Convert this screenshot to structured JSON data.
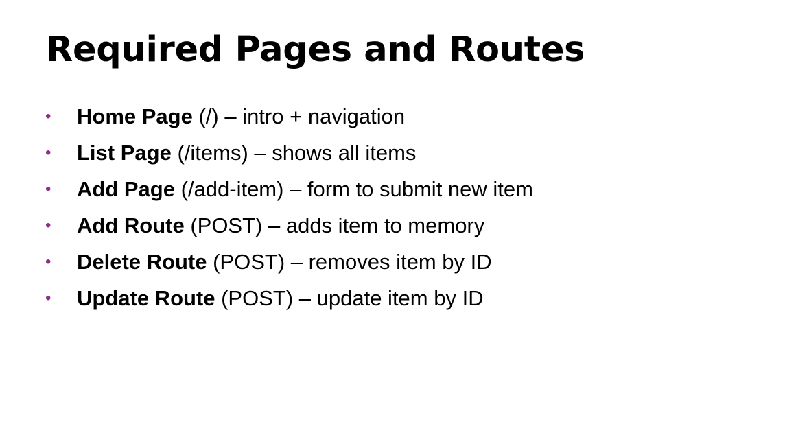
{
  "slide": {
    "title": "Required Pages and Routes",
    "bullet_color": "#8b2f8b",
    "bullet_glyph": "•",
    "items": [
      {
        "bold": "Home Page",
        "rest": " (/) – intro + navigation"
      },
      {
        "bold": "List Page",
        "rest": " (/items) – shows all items"
      },
      {
        "bold": "Add Page",
        "rest": " (/add-item) – form to submit new item"
      },
      {
        "bold": "Add Route",
        "rest": " (POST) – adds item to memory"
      },
      {
        "bold": "Delete Route",
        "rest": " (POST) – removes item by ID"
      },
      {
        "bold": "Update Route",
        "rest": " (POST) – update item by ID"
      }
    ]
  }
}
